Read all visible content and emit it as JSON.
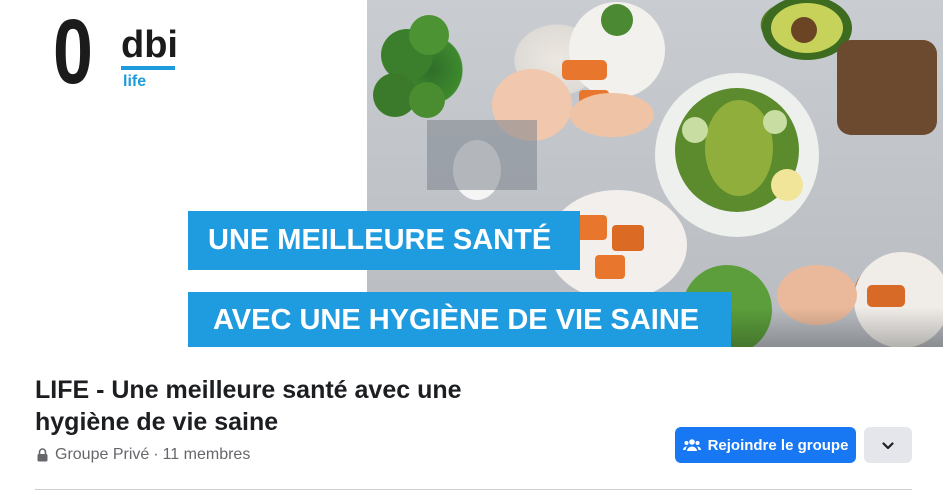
{
  "cover": {
    "brand": {
      "mark": "0",
      "name": "dbi",
      "sub": "life"
    },
    "headline_line1": "UNE MEILLEURE SANTÉ",
    "headline_line2": "AVEC UNE HYGIÈNE DE VIE SAINE"
  },
  "group": {
    "title": "LIFE - Une meilleure santé avec une hygiène de vie saine",
    "privacy": "Groupe Privé",
    "separator": "·",
    "members": "11 membres"
  },
  "actions": {
    "join_label": "Rejoindre le groupe",
    "join_icon": "group-icon",
    "more_icon": "chevron-down-icon"
  },
  "colors": {
    "accent": "#1877f2",
    "headline_bg": "#1f9ce0",
    "brand_blue": "#1f9bdb"
  }
}
